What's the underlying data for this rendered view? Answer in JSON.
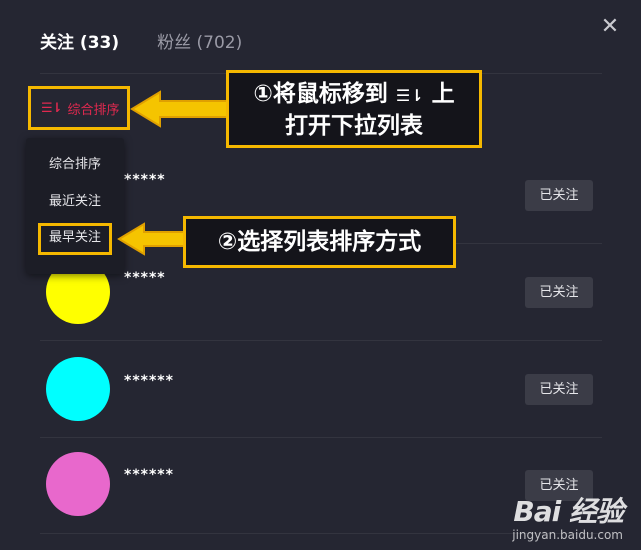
{
  "tabs": [
    {
      "label": "关注 (33)",
      "active": true
    },
    {
      "label": "粉丝 (702)",
      "active": false
    }
  ],
  "close": {
    "glyph": "✕",
    "icon": "close-icon"
  },
  "sort": {
    "icon_glyph": "☰⇂",
    "current": "综合排序",
    "options": [
      "综合排序",
      "最近关注",
      "最早关注"
    ],
    "highlighted": "最早关注"
  },
  "follows": [
    {
      "name": "*****",
      "avatar_color": null,
      "button": "已关注"
    },
    {
      "name": "*****",
      "avatar_color": "#ffff00",
      "button": "已关注"
    },
    {
      "name": "******",
      "avatar_color": "#00ffff",
      "button": "已关注"
    },
    {
      "name": "******",
      "avatar_color": "#e868cc",
      "button": "已关注"
    }
  ],
  "annotations": {
    "step1_line1_prefix": "①将鼠标移到",
    "step1_line1_icon": "☰⇂",
    "step1_line1_suffix": "上",
    "step1_line2": "打开下拉列表",
    "step2": "②选择列表排序方式"
  },
  "watermark": {
    "logo": "Bai  经验",
    "url": "jingyan.baidu.com"
  },
  "colors": {
    "accent_red": "#e0294f",
    "callout_border": "#f5b800",
    "panel_bg": "#252632"
  }
}
